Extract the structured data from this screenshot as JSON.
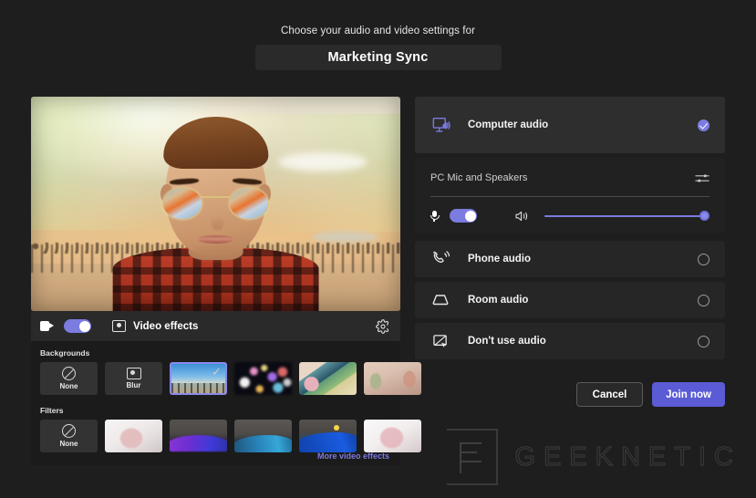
{
  "header": {
    "subtitle": "Choose your audio and video settings for",
    "meeting_title": "Marketing Sync"
  },
  "video": {
    "preview_alt": "camera-preview",
    "camera_icon": "video-camera-icon",
    "camera_toggle_on": "on",
    "effects_icon": "video-effects-icon",
    "effects_label": "Video effects",
    "settings_icon": "gear-icon"
  },
  "effects": {
    "backgrounds_label": "Backgrounds",
    "filters_label": "Filters",
    "more_link": "More video effects",
    "backgrounds": [
      {
        "label": "None",
        "kind": "none",
        "selected": false
      },
      {
        "label": "Blur",
        "kind": "blur",
        "selected": false
      },
      {
        "label": "",
        "kind": "bg-beach",
        "selected": true
      },
      {
        "label": "",
        "kind": "bg-bokeh",
        "selected": false
      },
      {
        "label": "",
        "kind": "bg-illus",
        "selected": false
      },
      {
        "label": "",
        "kind": "bg-room",
        "selected": false
      }
    ],
    "filters": [
      {
        "label": "None",
        "kind": "none",
        "selected": false
      },
      {
        "label": "",
        "kind": "ft-light",
        "selected": false
      },
      {
        "label": "",
        "kind": "ft-purple",
        "selected": false
      },
      {
        "label": "",
        "kind": "ft-teal",
        "selected": false
      },
      {
        "label": "",
        "kind": "ft-blue",
        "selected": false
      },
      {
        "label": "",
        "kind": "ft-light2",
        "selected": false
      }
    ]
  },
  "audio": {
    "options": [
      {
        "label": "Computer audio",
        "icon": "computer-audio-icon",
        "selected": true
      },
      {
        "label": "Phone audio",
        "icon": "phone-audio-icon",
        "selected": false
      },
      {
        "label": "Room audio",
        "icon": "room-audio-icon",
        "selected": false
      },
      {
        "label": "Don't use audio",
        "icon": "no-audio-icon",
        "selected": false
      }
    ],
    "device": {
      "name": "PC Mic and Speakers",
      "settings_icon": "audio-settings-sliders-icon",
      "mic_icon": "microphone-icon",
      "mic_toggle_on": "on",
      "speaker_icon": "speaker-icon",
      "volume_percent": 100
    }
  },
  "actions": {
    "cancel_label": "Cancel",
    "join_label": "Join now"
  },
  "watermark": {
    "text": "GEEKNETIC"
  },
  "colors": {
    "accent": "#5b5bd6",
    "toggle": "#7b7be0",
    "page_bg": "#1e1e1e",
    "card_bg": "#262626",
    "card_active_bg": "#2e2e2e",
    "link": "#7b7be0"
  }
}
